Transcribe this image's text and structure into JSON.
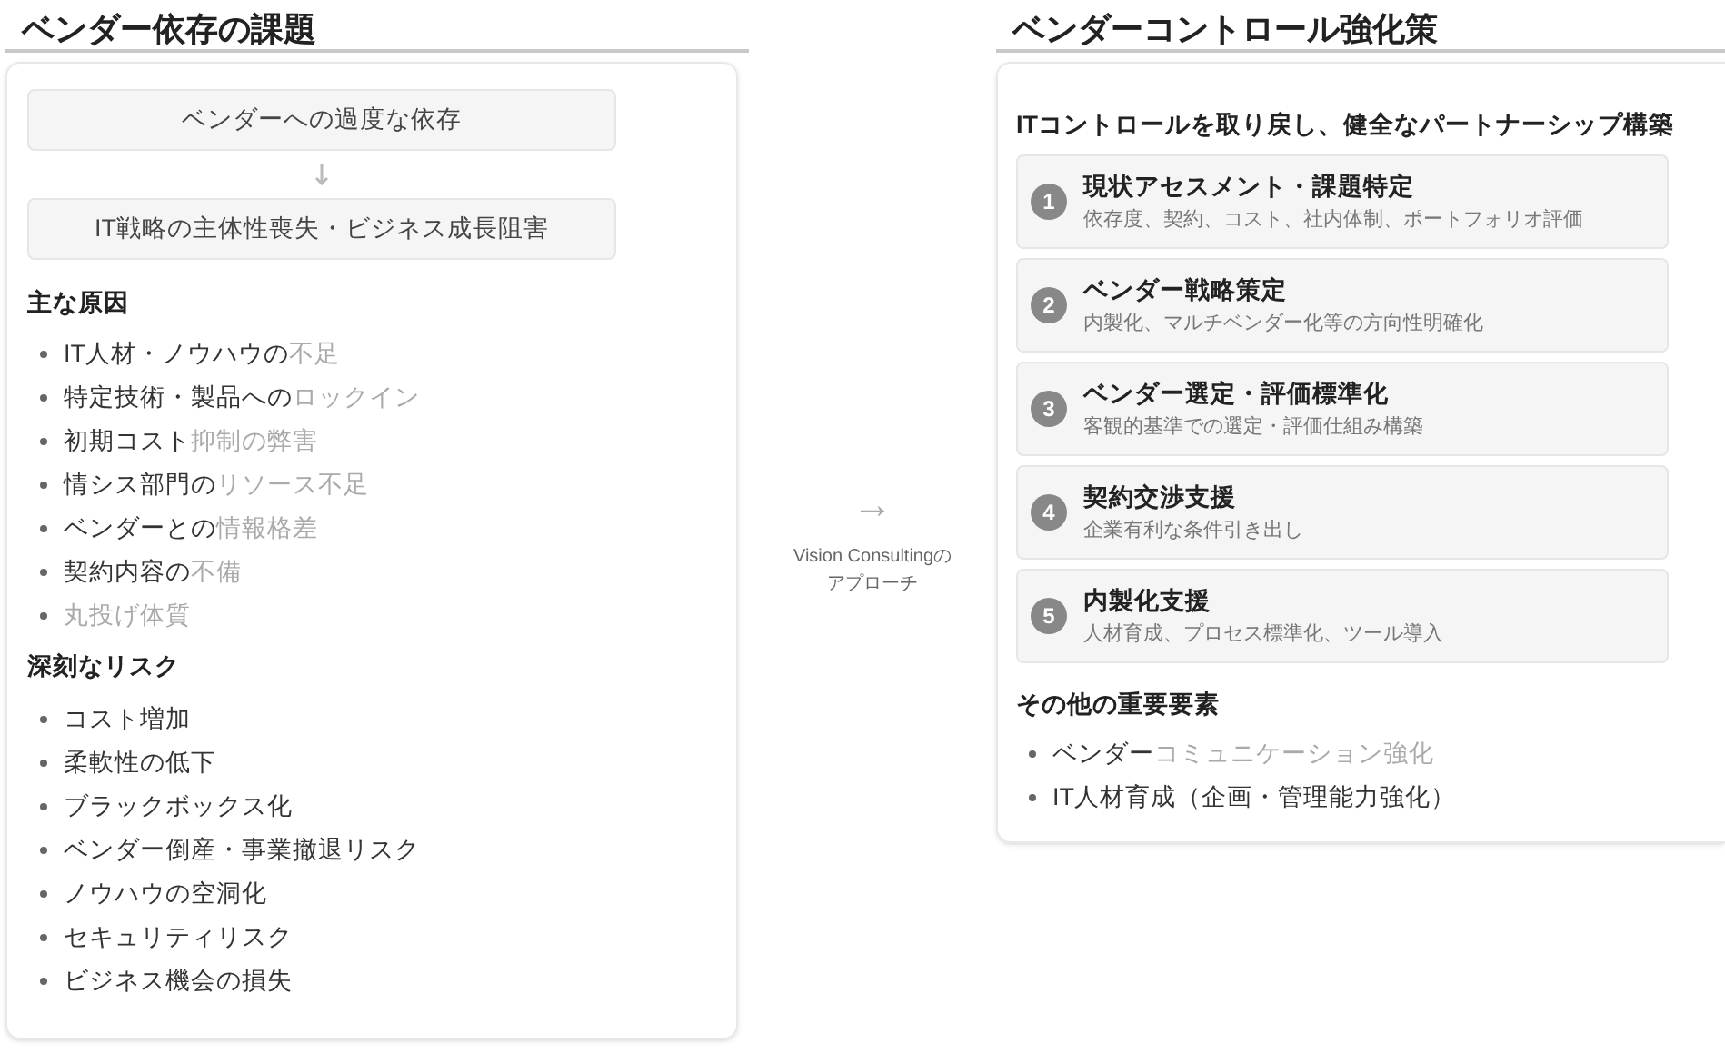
{
  "left": {
    "title": "ベンダー依存の課題",
    "flow": [
      "ベンダーへの過度な依存",
      "IT戦略の主体性喪失・ビジネス成長阻害"
    ],
    "causes_heading": "主な原因",
    "causes": [
      {
        "text": "IT人材・ノウハウの",
        "faded": "不足"
      },
      {
        "text": "特定技術・製品への",
        "faded": "ロックイン"
      },
      {
        "text": "初期コスト",
        "faded": "抑制の弊害"
      },
      {
        "text": "情シス部門の",
        "faded": "リソース不足"
      },
      {
        "text": "ベンダーとの",
        "faded": "情報格差"
      },
      {
        "text": "契約内容の",
        "faded": "不備"
      },
      {
        "faded": "丸投げ体質"
      }
    ],
    "risks_heading": "深刻なリスク",
    "risks": [
      {
        "text": "コスト増加"
      },
      {
        "text": "柔軟性の低下"
      },
      {
        "text": "ブラックボックス化"
      },
      {
        "text": "ベンダー倒産・事業撤退リスク"
      },
      {
        "text": "ノウハウの空洞化"
      },
      {
        "text": "セキュリティリスク"
      },
      {
        "text": "ビジネス機会の損失"
      }
    ]
  },
  "middle": {
    "arrow": "→",
    "caption": "Vision Consultingの",
    "caption_2": "アプローチ"
  },
  "right": {
    "title": "ベンダーコントロール強化策",
    "subtitle": "ITコントロールを取り戻し、健全なパートナーシップ構築",
    "steps": [
      {
        "number": "1",
        "title": "現状アセスメント・課題特定",
        "desc": "依存度、契約、コスト、社内体制、ポートフォリオ評価"
      },
      {
        "number": "2",
        "title": "ベンダー戦略策定",
        "desc": "内製化、マルチベンダー化等の方向性明確化"
      },
      {
        "number": "3",
        "title": "ベンダー選定・評価標準化",
        "desc": "客観的基準での選定・評価仕組み構築"
      },
      {
        "number": "4",
        "title": "契約交渉支援",
        "desc": "企業有利な条件引き出し"
      },
      {
        "number": "5",
        "title": "内製化支援",
        "desc": "人材育成、プロセス標準化、ツール導入"
      }
    ],
    "others_heading": "その他の重要要素",
    "others": [
      {
        "text": "ベンダー",
        "faded": "コミュニケーション強化"
      },
      {
        "text": "IT人材育成（企画・管理能力強化）"
      }
    ]
  }
}
